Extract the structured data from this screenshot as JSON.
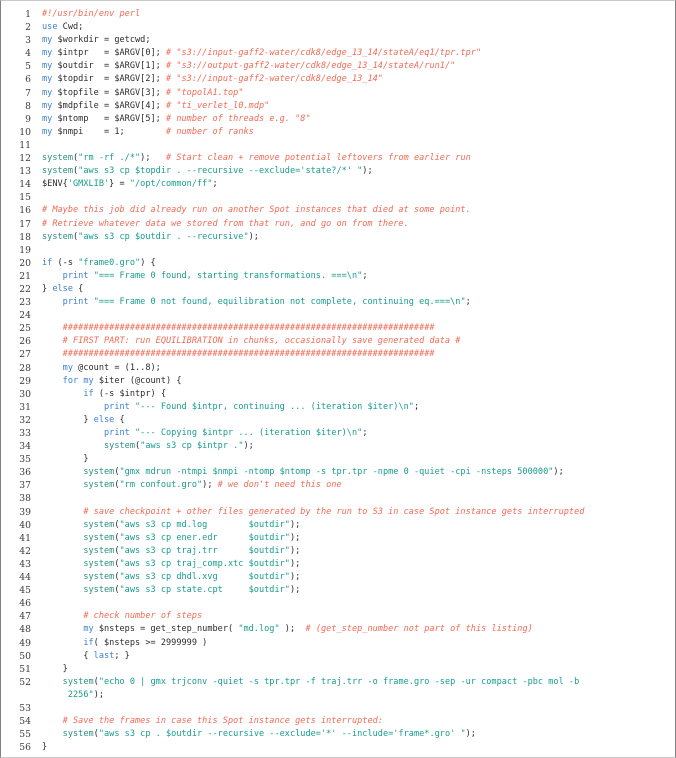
{
  "listing": {
    "language": "perl",
    "title": "Perl driver script for GROMACS equilibration on AWS Spot",
    "colors": {
      "background": "#ffffff",
      "border": "#808080",
      "lineno": "#3a3a3a",
      "keyword": "#3a7fd5",
      "string": "#179c8c",
      "comment": "#f26a55",
      "function": "#2a8f80",
      "plain": "#2b2b2b"
    },
    "first_line_number": 1,
    "last_line_number": 56,
    "lines": [
      {
        "n": "1",
        "tokens": [
          {
            "t": "cmt",
            "s": "#!/usr/bin/env perl"
          }
        ]
      },
      {
        "n": "2",
        "tokens": [
          {
            "t": "kw",
            "s": "use"
          },
          {
            "t": "plain",
            "s": " Cwd;"
          }
        ]
      },
      {
        "n": "3",
        "tokens": [
          {
            "t": "kw",
            "s": "my"
          },
          {
            "t": "plain",
            "s": " $workdir = getcwd;"
          }
        ]
      },
      {
        "n": "4",
        "tokens": [
          {
            "t": "kw",
            "s": "my"
          },
          {
            "t": "plain",
            "s": " $intpr   = $ARGV[0]; "
          },
          {
            "t": "cmt",
            "s": "# \"s3://input-gaff2-water/cdk8/edge_13_14/stateA/eq1/tpr.tpr\""
          }
        ]
      },
      {
        "n": "5",
        "tokens": [
          {
            "t": "kw",
            "s": "my"
          },
          {
            "t": "plain",
            "s": " $outdir  = $ARGV[1]; "
          },
          {
            "t": "cmt",
            "s": "# \"s3://output-gaff2-water/cdk8/edge_13_14/stateA/run1/\""
          }
        ]
      },
      {
        "n": "6",
        "tokens": [
          {
            "t": "kw",
            "s": "my"
          },
          {
            "t": "plain",
            "s": " $topdir  = $ARGV[2]; "
          },
          {
            "t": "cmt",
            "s": "# \"s3://input-gaff2-water/cdk8/edge_13_14\""
          }
        ]
      },
      {
        "n": "7",
        "tokens": [
          {
            "t": "kw",
            "s": "my"
          },
          {
            "t": "plain",
            "s": " $topfile = $ARGV[3]; "
          },
          {
            "t": "cmt",
            "s": "# \"topolA1.top\""
          }
        ]
      },
      {
        "n": "8",
        "tokens": [
          {
            "t": "kw",
            "s": "my"
          },
          {
            "t": "plain",
            "s": " $mdpfile = $ARGV[4]; "
          },
          {
            "t": "cmt",
            "s": "# \"ti_verlet_l0.mdp\""
          }
        ]
      },
      {
        "n": "9",
        "tokens": [
          {
            "t": "kw",
            "s": "my"
          },
          {
            "t": "plain",
            "s": " $ntomp   = $ARGV[5]; "
          },
          {
            "t": "cmt",
            "s": "# number of threads e.g. \"8\""
          }
        ]
      },
      {
        "n": "10",
        "tokens": [
          {
            "t": "kw",
            "s": "my"
          },
          {
            "t": "plain",
            "s": " $nmpi    = 1;        "
          },
          {
            "t": "cmt",
            "s": "# number of ranks"
          }
        ]
      },
      {
        "n": "11",
        "tokens": []
      },
      {
        "n": "12",
        "tokens": [
          {
            "t": "fn",
            "s": "system"
          },
          {
            "t": "plain",
            "s": "("
          },
          {
            "t": "str",
            "s": "\"rm -rf ./*\""
          },
          {
            "t": "plain",
            "s": ");   "
          },
          {
            "t": "cmt",
            "s": "# Start clean + remove potential leftovers from earlier run"
          }
        ]
      },
      {
        "n": "13",
        "tokens": [
          {
            "t": "fn",
            "s": "system"
          },
          {
            "t": "plain",
            "s": "("
          },
          {
            "t": "str",
            "s": "\"aws s3 cp $topdir . --recursive --exclude='state?/*' \""
          },
          {
            "t": "plain",
            "s": ");"
          }
        ]
      },
      {
        "n": "14",
        "tokens": [
          {
            "t": "plain",
            "s": "$ENV{"
          },
          {
            "t": "str",
            "s": "'GMXLIB'"
          },
          {
            "t": "plain",
            "s": "} = "
          },
          {
            "t": "str",
            "s": "\"/opt/common/ff\""
          },
          {
            "t": "plain",
            "s": ";"
          }
        ]
      },
      {
        "n": "15",
        "tokens": []
      },
      {
        "n": "16",
        "tokens": [
          {
            "t": "cmt",
            "s": "# Maybe this job did already run on another Spot instances that died at some point."
          }
        ]
      },
      {
        "n": "17",
        "tokens": [
          {
            "t": "cmt",
            "s": "# Retrieve whatever data we stored from that run, and go on from there."
          }
        ]
      },
      {
        "n": "18",
        "tokens": [
          {
            "t": "fn",
            "s": "system"
          },
          {
            "t": "plain",
            "s": "("
          },
          {
            "t": "str",
            "s": "\"aws s3 cp $outdir . --recursive\""
          },
          {
            "t": "plain",
            "s": ");"
          }
        ]
      },
      {
        "n": "19",
        "tokens": []
      },
      {
        "n": "20",
        "tokens": [
          {
            "t": "kw",
            "s": "if"
          },
          {
            "t": "plain",
            "s": " (-s "
          },
          {
            "t": "str",
            "s": "\"frame0.gro\""
          },
          {
            "t": "plain",
            "s": ") {"
          }
        ]
      },
      {
        "n": "21",
        "tokens": [
          {
            "t": "plain",
            "s": "    "
          },
          {
            "t": "kw",
            "s": "print"
          },
          {
            "t": "plain",
            "s": " "
          },
          {
            "t": "str",
            "s": "\"=== Frame 0 found, starting transformations. ===\\n\""
          },
          {
            "t": "plain",
            "s": ";"
          }
        ]
      },
      {
        "n": "22",
        "tokens": [
          {
            "t": "plain",
            "s": "} "
          },
          {
            "t": "kw",
            "s": "else"
          },
          {
            "t": "plain",
            "s": " {"
          }
        ]
      },
      {
        "n": "23",
        "tokens": [
          {
            "t": "plain",
            "s": "    "
          },
          {
            "t": "kw",
            "s": "print"
          },
          {
            "t": "plain",
            "s": " "
          },
          {
            "t": "str",
            "s": "\"=== Frame 0 not found, equilibration not complete, continuing eq.===\\n\""
          },
          {
            "t": "plain",
            "s": ";"
          }
        ]
      },
      {
        "n": "24",
        "tokens": []
      },
      {
        "n": "25",
        "tokens": [
          {
            "t": "plain",
            "s": "    "
          },
          {
            "t": "cmt",
            "s": "########################################################################"
          }
        ]
      },
      {
        "n": "26",
        "tokens": [
          {
            "t": "plain",
            "s": "    "
          },
          {
            "t": "cmt",
            "s": "# FIRST PART: run EQUILIBRATION in chunks, occasionally save generated data #"
          }
        ]
      },
      {
        "n": "27",
        "tokens": [
          {
            "t": "plain",
            "s": "    "
          },
          {
            "t": "cmt",
            "s": "########################################################################"
          }
        ]
      },
      {
        "n": "28",
        "tokens": [
          {
            "t": "plain",
            "s": "    "
          },
          {
            "t": "kw",
            "s": "my"
          },
          {
            "t": "plain",
            "s": " @count = (1..8);"
          }
        ]
      },
      {
        "n": "29",
        "tokens": [
          {
            "t": "plain",
            "s": "    "
          },
          {
            "t": "kw",
            "s": "for"
          },
          {
            "t": "plain",
            "s": " "
          },
          {
            "t": "kw",
            "s": "my"
          },
          {
            "t": "plain",
            "s": " $iter (@count) {"
          }
        ]
      },
      {
        "n": "30",
        "tokens": [
          {
            "t": "plain",
            "s": "        "
          },
          {
            "t": "kw",
            "s": "if"
          },
          {
            "t": "plain",
            "s": " (-s $intpr) {"
          }
        ]
      },
      {
        "n": "31",
        "tokens": [
          {
            "t": "plain",
            "s": "            "
          },
          {
            "t": "kw",
            "s": "print"
          },
          {
            "t": "plain",
            "s": " "
          },
          {
            "t": "str",
            "s": "\"--- Found $intpr, continuing ... (iteration $iter)\\n\""
          },
          {
            "t": "plain",
            "s": ";"
          }
        ]
      },
      {
        "n": "32",
        "tokens": [
          {
            "t": "plain",
            "s": "        } "
          },
          {
            "t": "kw",
            "s": "else"
          },
          {
            "t": "plain",
            "s": " {"
          }
        ]
      },
      {
        "n": "33",
        "tokens": [
          {
            "t": "plain",
            "s": "            "
          },
          {
            "t": "kw",
            "s": "print"
          },
          {
            "t": "plain",
            "s": " "
          },
          {
            "t": "str",
            "s": "\"--- Copying $intpr ... (iteration $iter)\\n\""
          },
          {
            "t": "plain",
            "s": ";"
          }
        ]
      },
      {
        "n": "34",
        "tokens": [
          {
            "t": "plain",
            "s": "            "
          },
          {
            "t": "fn",
            "s": "system"
          },
          {
            "t": "plain",
            "s": "("
          },
          {
            "t": "str",
            "s": "\"aws s3 cp $intpr .\""
          },
          {
            "t": "plain",
            "s": ");"
          }
        ]
      },
      {
        "n": "35",
        "tokens": [
          {
            "t": "plain",
            "s": "        }"
          }
        ]
      },
      {
        "n": "36",
        "tokens": [
          {
            "t": "plain",
            "s": "        "
          },
          {
            "t": "fn",
            "s": "system"
          },
          {
            "t": "plain",
            "s": "("
          },
          {
            "t": "str",
            "s": "\"gmx mdrun -ntmpi $nmpi -ntomp $ntomp -s tpr.tpr -npme 0 -quiet -cpi -nsteps 500000\""
          },
          {
            "t": "plain",
            "s": ");"
          }
        ]
      },
      {
        "n": "37",
        "tokens": [
          {
            "t": "plain",
            "s": "        "
          },
          {
            "t": "fn",
            "s": "system"
          },
          {
            "t": "plain",
            "s": "("
          },
          {
            "t": "str",
            "s": "\"rm confout.gro\""
          },
          {
            "t": "plain",
            "s": "); "
          },
          {
            "t": "cmt",
            "s": "# we don't need this one"
          }
        ]
      },
      {
        "n": "38",
        "tokens": []
      },
      {
        "n": "39",
        "tokens": [
          {
            "t": "plain",
            "s": "        "
          },
          {
            "t": "cmt",
            "s": "# save checkpoint + other files generated by the run to S3 in case Spot instance gets interrupted"
          }
        ]
      },
      {
        "n": "40",
        "tokens": [
          {
            "t": "plain",
            "s": "        "
          },
          {
            "t": "fn",
            "s": "system"
          },
          {
            "t": "plain",
            "s": "("
          },
          {
            "t": "str",
            "s": "\"aws s3 cp md.log        $outdir\""
          },
          {
            "t": "plain",
            "s": ");"
          }
        ]
      },
      {
        "n": "41",
        "tokens": [
          {
            "t": "plain",
            "s": "        "
          },
          {
            "t": "fn",
            "s": "system"
          },
          {
            "t": "plain",
            "s": "("
          },
          {
            "t": "str",
            "s": "\"aws s3 cp ener.edr      $outdir\""
          },
          {
            "t": "plain",
            "s": ");"
          }
        ]
      },
      {
        "n": "42",
        "tokens": [
          {
            "t": "plain",
            "s": "        "
          },
          {
            "t": "fn",
            "s": "system"
          },
          {
            "t": "plain",
            "s": "("
          },
          {
            "t": "str",
            "s": "\"aws s3 cp traj.trr      $outdir\""
          },
          {
            "t": "plain",
            "s": ");"
          }
        ]
      },
      {
        "n": "43",
        "tokens": [
          {
            "t": "plain",
            "s": "        "
          },
          {
            "t": "fn",
            "s": "system"
          },
          {
            "t": "plain",
            "s": "("
          },
          {
            "t": "str",
            "s": "\"aws s3 cp traj_comp.xtc $outdir\""
          },
          {
            "t": "plain",
            "s": ");"
          }
        ]
      },
      {
        "n": "44",
        "tokens": [
          {
            "t": "plain",
            "s": "        "
          },
          {
            "t": "fn",
            "s": "system"
          },
          {
            "t": "plain",
            "s": "("
          },
          {
            "t": "str",
            "s": "\"aws s3 cp dhdl.xvg      $outdir\""
          },
          {
            "t": "plain",
            "s": ");"
          }
        ]
      },
      {
        "n": "45",
        "tokens": [
          {
            "t": "plain",
            "s": "        "
          },
          {
            "t": "fn",
            "s": "system"
          },
          {
            "t": "plain",
            "s": "("
          },
          {
            "t": "str",
            "s": "\"aws s3 cp state.cpt     $outdir\""
          },
          {
            "t": "plain",
            "s": ");"
          }
        ]
      },
      {
        "n": "46",
        "tokens": []
      },
      {
        "n": "47",
        "tokens": [
          {
            "t": "plain",
            "s": "        "
          },
          {
            "t": "cmt",
            "s": "# check number of steps"
          }
        ]
      },
      {
        "n": "48",
        "tokens": [
          {
            "t": "plain",
            "s": "        "
          },
          {
            "t": "kw",
            "s": "my"
          },
          {
            "t": "plain",
            "s": " $nsteps = get_step_number( "
          },
          {
            "t": "str",
            "s": "\"md.log\""
          },
          {
            "t": "plain",
            "s": " );  "
          },
          {
            "t": "cmt",
            "s": "# (get_step_number not part of this listing)"
          }
        ]
      },
      {
        "n": "49",
        "tokens": [
          {
            "t": "plain",
            "s": "        "
          },
          {
            "t": "kw",
            "s": "if"
          },
          {
            "t": "plain",
            "s": "( $nsteps >= 2999999 )"
          }
        ]
      },
      {
        "n": "50",
        "tokens": [
          {
            "t": "plain",
            "s": "        { "
          },
          {
            "t": "kw",
            "s": "last"
          },
          {
            "t": "plain",
            "s": "; }"
          }
        ]
      },
      {
        "n": "51",
        "tokens": [
          {
            "t": "plain",
            "s": "    }"
          }
        ]
      },
      {
        "n": "52",
        "tokens": [
          {
            "t": "plain",
            "s": "    "
          },
          {
            "t": "fn",
            "s": "system"
          },
          {
            "t": "plain",
            "s": "("
          },
          {
            "t": "str",
            "s": "\"echo 0 | gmx trjconv -quiet -s tpr.tpr -f traj.trr -o frame.gro -sep -ur compact -pbc mol -b"
          }
        ]
      },
      {
        "n": "",
        "tokens": [
          {
            "t": "plain",
            "s": "     "
          },
          {
            "t": "str",
            "s": "2256\""
          },
          {
            "t": "plain",
            "s": ");"
          }
        ]
      },
      {
        "n": "53",
        "tokens": []
      },
      {
        "n": "54",
        "tokens": [
          {
            "t": "plain",
            "s": "    "
          },
          {
            "t": "cmt",
            "s": "# Save the frames in case this Spot instance gets interrupted:"
          }
        ]
      },
      {
        "n": "55",
        "tokens": [
          {
            "t": "plain",
            "s": "    "
          },
          {
            "t": "fn",
            "s": "system"
          },
          {
            "t": "plain",
            "s": "("
          },
          {
            "t": "str",
            "s": "\"aws s3 cp . $outdir --recursive --exclude='*' --include='frame*.gro' \""
          },
          {
            "t": "plain",
            "s": ");"
          }
        ]
      },
      {
        "n": "56",
        "tokens": [
          {
            "t": "plain",
            "s": "}"
          }
        ]
      }
    ]
  }
}
